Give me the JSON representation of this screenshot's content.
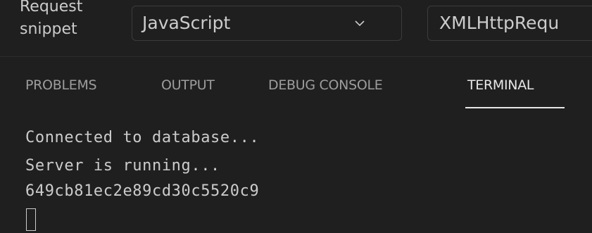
{
  "snippet": {
    "label": "Request\nsnippet",
    "language_select": "JavaScript",
    "library_select": "XMLHttpRequ"
  },
  "panel": {
    "tabs": [
      "PROBLEMS",
      "OUTPUT",
      "DEBUG CONSOLE",
      "TERMINAL"
    ],
    "active_tab": "TERMINAL"
  },
  "terminal": {
    "lines": [
      "Connected to database...",
      "Server is running...",
      "649cb81ec2e89cd30c5520c9"
    ]
  },
  "colors": {
    "background": "#1f1f1f",
    "text": "#cccccc",
    "active_tab": "#e7e7e7",
    "inactive_tab": "#9d9d9d"
  }
}
